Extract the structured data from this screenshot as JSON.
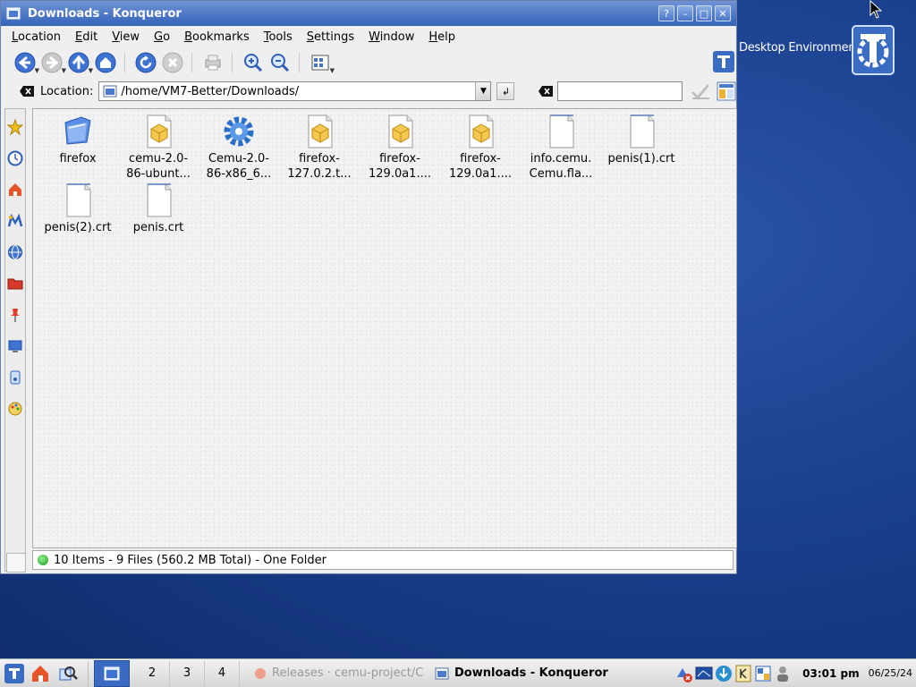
{
  "desktop": {
    "brand_text": "Desktop Environment"
  },
  "window": {
    "title": "Downloads - Konqueror",
    "controls": {
      "help": "?",
      "minimize": "–",
      "maximize": "□",
      "close": "✕"
    }
  },
  "menubar": {
    "items": [
      "Location",
      "Edit",
      "View",
      "Go",
      "Bookmarks",
      "Tools",
      "Settings",
      "Window",
      "Help"
    ]
  },
  "locbar": {
    "label": "Location:",
    "path": "/home/VM7-Better/Downloads/"
  },
  "files": [
    {
      "line1": "firefox",
      "line2": "",
      "kind": "folder"
    },
    {
      "line1": "cemu-2.0-",
      "line2": "86-ubunt...",
      "kind": "package"
    },
    {
      "line1": "Cemu-2.0-",
      "line2": "86-x86_6...",
      "kind": "gear"
    },
    {
      "line1": "firefox-",
      "line2": "127.0.2.t...",
      "kind": "package"
    },
    {
      "line1": "firefox-",
      "line2": "129.0a1....",
      "kind": "package"
    },
    {
      "line1": "firefox-",
      "line2": "129.0a1....",
      "kind": "package"
    },
    {
      "line1": "info.cemu.",
      "line2": "Cemu.fla...",
      "kind": "doc"
    },
    {
      "line1": "penis(1).crt",
      "line2": "",
      "kind": "doc"
    },
    {
      "line1": "penis(2).crt",
      "line2": "",
      "kind": "doc"
    },
    {
      "line1": "penis.crt",
      "line2": "",
      "kind": "doc"
    }
  ],
  "status": {
    "text": "10 Items - 9 Files (560.2 MB Total) - One Folder"
  },
  "taskbar": {
    "pager": [
      "",
      "2",
      "3",
      "4"
    ],
    "tasks": [
      {
        "label": "Releases · cemu-project/C",
        "active": false
      },
      {
        "label": "Downloads - Konqueror",
        "active": true
      }
    ],
    "clock": "03:01 pm",
    "date": "06/25/24"
  }
}
